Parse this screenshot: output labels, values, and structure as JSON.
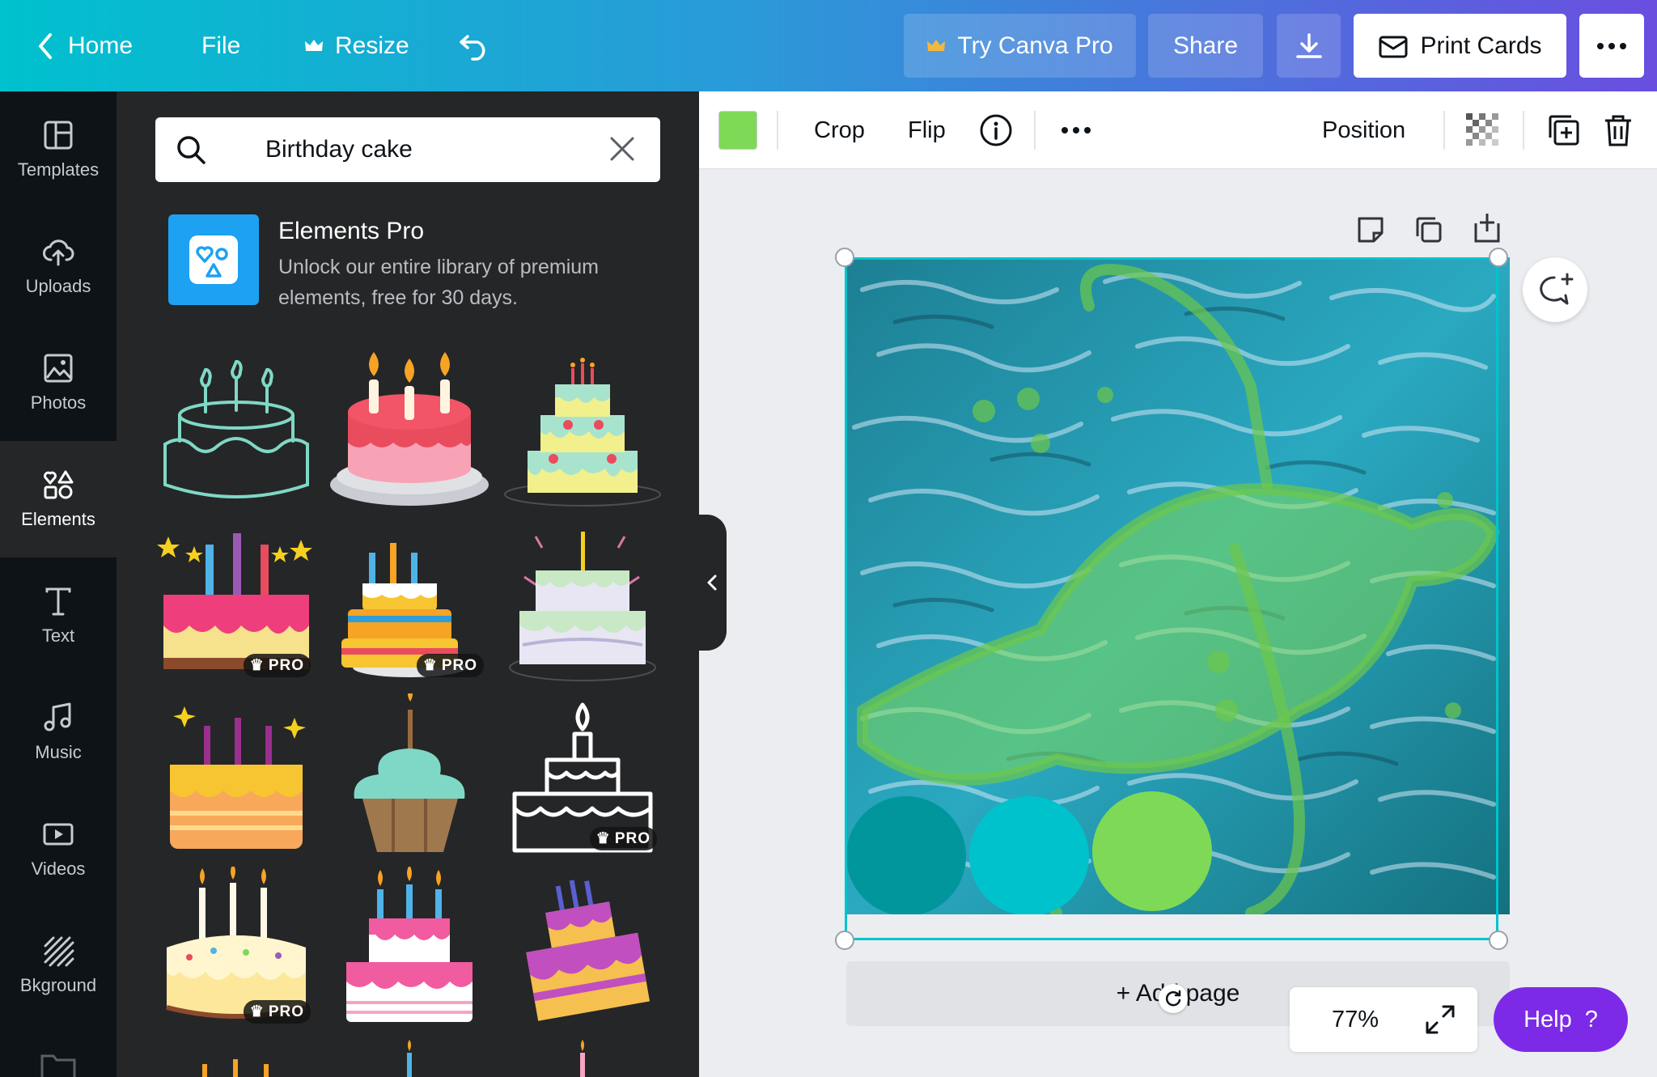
{
  "topbar": {
    "home": "Home",
    "file": "File",
    "resize": "Resize",
    "try_pro": "Try Canva Pro",
    "share": "Share",
    "print": "Print Cards"
  },
  "sidenav": [
    {
      "label": "Templates",
      "icon": "templates-icon"
    },
    {
      "label": "Uploads",
      "icon": "cloud-upload-icon"
    },
    {
      "label": "Photos",
      "icon": "image-icon"
    },
    {
      "label": "Elements",
      "icon": "shapes-icon"
    },
    {
      "label": "Text",
      "icon": "text-icon"
    },
    {
      "label": "Music",
      "icon": "music-icon"
    },
    {
      "label": "Videos",
      "icon": "video-icon"
    },
    {
      "label": "Bkground",
      "icon": "background-icon"
    }
  ],
  "search": {
    "value": "Birthday cake"
  },
  "promo": {
    "title": "Elements Pro",
    "description": "Unlock our entire library of premium elements, free for 30 days."
  },
  "pro_label": "PRO",
  "toolbar": {
    "crop": "Crop",
    "flip": "Flip",
    "position": "Position",
    "swatch_color": "#7ed957"
  },
  "canvas": {
    "add_page": "+ Add page",
    "zoom": "77%",
    "palette": [
      "#00969c",
      "#00c2cc",
      "#7ed957"
    ]
  },
  "help": {
    "label": "Help",
    "icon": "?"
  }
}
